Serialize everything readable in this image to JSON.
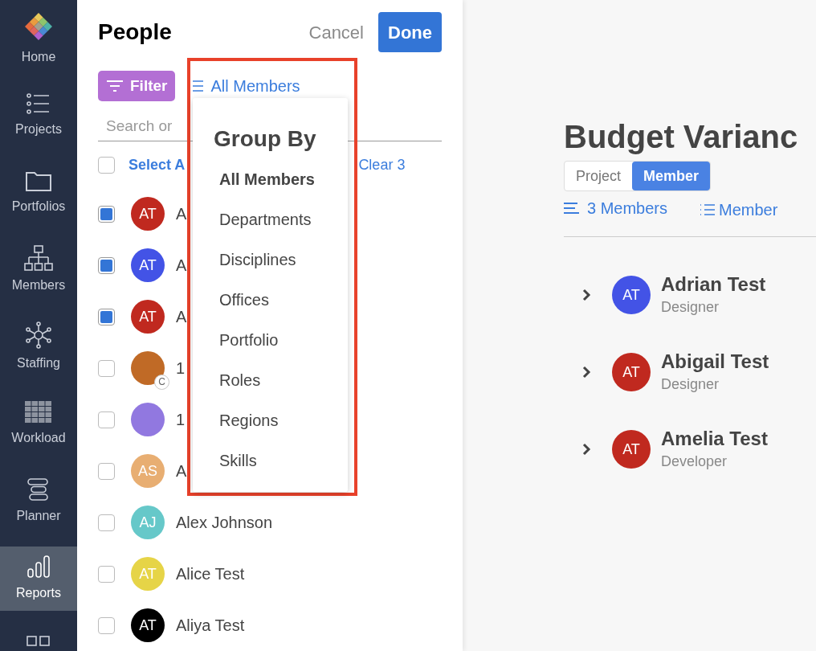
{
  "nav": [
    {
      "label": "Home",
      "kind": "logo",
      "selected": false
    },
    {
      "label": "Projects",
      "kind": "list",
      "selected": false
    },
    {
      "label": "Portfolios",
      "kind": "folder",
      "selected": false
    },
    {
      "label": "Members",
      "kind": "org",
      "selected": false
    },
    {
      "label": "Staffing",
      "kind": "hub",
      "selected": false
    },
    {
      "label": "Workload",
      "kind": "grid",
      "selected": false
    },
    {
      "label": "Planner",
      "kind": "bars",
      "selected": false
    },
    {
      "label": "Reports",
      "kind": "chart",
      "selected": true
    },
    {
      "kind": "squares",
      "selected": false
    }
  ],
  "select_all_checked": false,
  "panel": {
    "title": "People",
    "cancel": "Cancel",
    "done": "Done",
    "filter": "Filter",
    "group_by": "All Members",
    "search_placeholder": "Search or",
    "select_all": "Select A",
    "clear": "Clear 3",
    "people": [
      {
        "initials": "AT",
        "color": "#c0291f",
        "name": "A",
        "checked": true
      },
      {
        "initials": "AT",
        "color": "#4353e6",
        "name": "A",
        "checked": true
      },
      {
        "initials": "AT",
        "color": "#c0291f",
        "name": "A",
        "checked": true
      },
      {
        "color": "#c06a26",
        "name": "1",
        "checked": false,
        "badge": "C"
      },
      {
        "color": "#9178e0",
        "name": "1",
        "checked": false
      },
      {
        "initials": "AS",
        "color": "#e8ae72",
        "name": "A",
        "checked": false
      },
      {
        "initials": "AJ",
        "color": "#66c8c9",
        "name": "Alex Johnson",
        "checked": false
      },
      {
        "initials": "AT",
        "color": "#e6d447",
        "name": "Alice Test",
        "checked": false
      },
      {
        "initials": "AT",
        "color": "#000000",
        "name": "Aliya Test",
        "checked": false
      }
    ]
  },
  "dropdown": {
    "title": "Group By",
    "options": [
      {
        "label": "All Members",
        "selected": true
      },
      {
        "label": "Departments",
        "selected": false
      },
      {
        "label": "Disciplines",
        "selected": false
      },
      {
        "label": "Offices",
        "selected": false
      },
      {
        "label": "Portfolio",
        "selected": false
      },
      {
        "label": "Roles",
        "selected": false
      },
      {
        "label": "Regions",
        "selected": false
      },
      {
        "label": "Skills",
        "selected": false
      }
    ]
  },
  "report": {
    "title": "Budget Varianc",
    "toggle": [
      {
        "label": "Project",
        "selected": false
      },
      {
        "label": "Member",
        "selected": true
      }
    ],
    "count": "3 Members",
    "group": "Member",
    "members": [
      {
        "initials": "AT",
        "color": "#4353e6",
        "name": "Adrian Test",
        "role": "Designer"
      },
      {
        "initials": "AT",
        "color": "#c0291f",
        "name": "Abigail Test",
        "role": "Designer"
      },
      {
        "initials": "AT",
        "color": "#c0291f",
        "name": "Amelia Test",
        "role": "Developer"
      }
    ]
  }
}
